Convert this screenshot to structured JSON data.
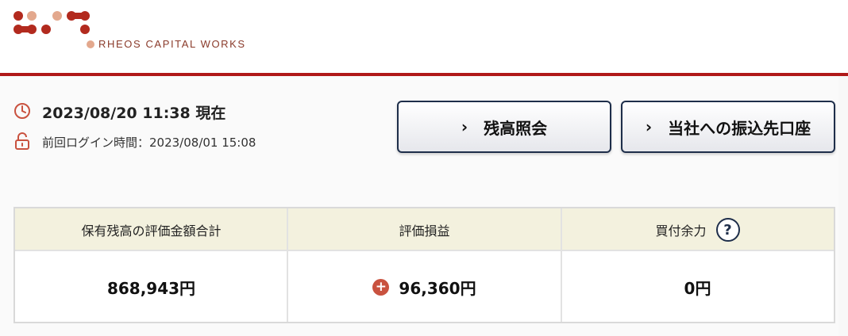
{
  "brand": {
    "name": "RHEOS CAPITAL WORKS",
    "colors": {
      "dark_dot": "#b22a1e",
      "light_dot": "#e3a88d",
      "rule": "#b01818"
    }
  },
  "status": {
    "current_time": "2023/08/20 11:38 現在",
    "last_login": "前回ログイン時間：2023/08/01 15:08"
  },
  "buttons": {
    "balance_inquiry": "残高照会",
    "transfer_account": "当社への振込先口座",
    "chevron": "›"
  },
  "summary": {
    "headers": [
      "保有残高の評価金額合計",
      "評価損益",
      "買付余力"
    ],
    "values": [
      "868,943円",
      "96,360円",
      "0円"
    ],
    "gain_sign": "+",
    "help_label": "?"
  },
  "icons": {
    "clock": "clock-icon",
    "lock": "unlock-icon",
    "help": "help-icon",
    "plus": "plus-icon"
  }
}
